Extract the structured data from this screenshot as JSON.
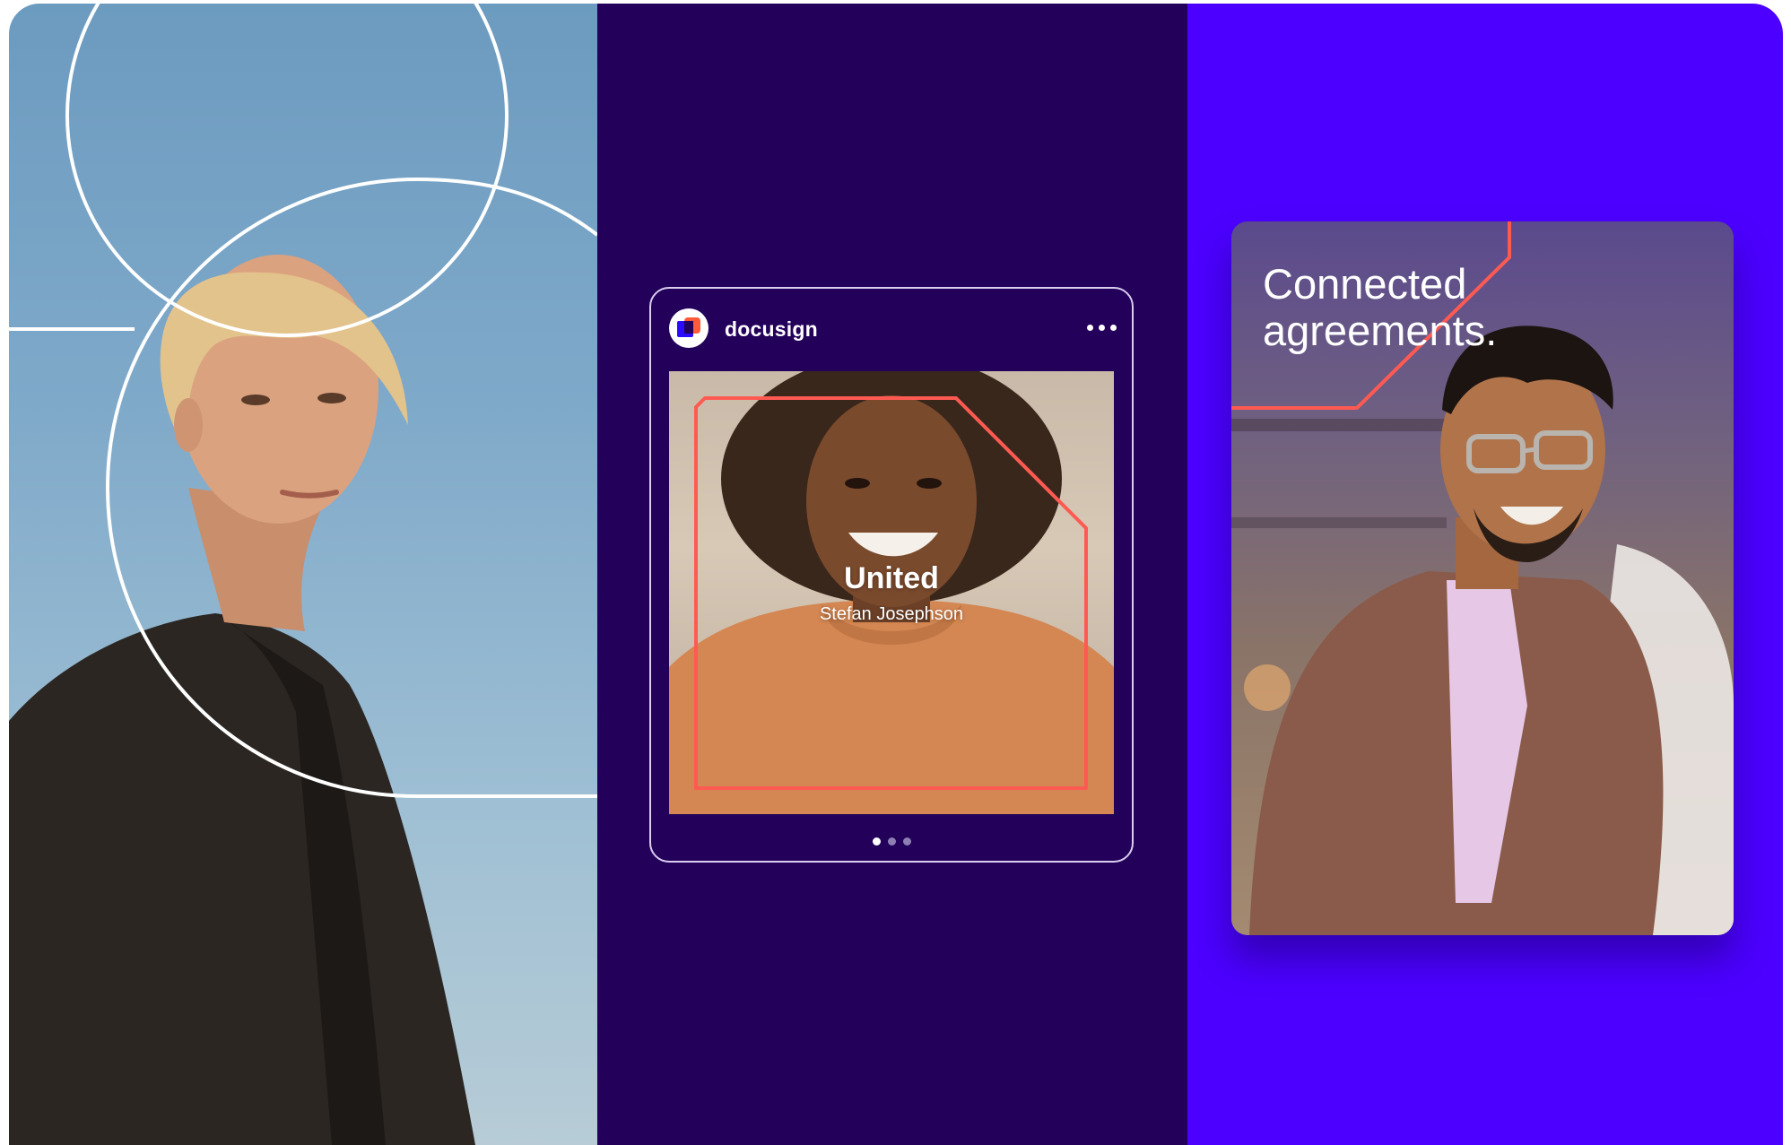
{
  "post": {
    "brand_name": "docusign",
    "image_title": "United",
    "image_subtitle": "Stefan Josephson",
    "pager": {
      "total": 3,
      "active_index": 0
    }
  },
  "ad": {
    "headline_line1": "Connected",
    "headline_line2": "agreements."
  },
  "colors": {
    "panel_dark": "#23005a",
    "panel_violet": "#4c00ff",
    "accent_coral": "#ff5a52",
    "ring_stroke": "#ffffff"
  },
  "icons": {
    "brand_logo": "docusign-logo-icon",
    "more": "more-horizontal-icon"
  }
}
